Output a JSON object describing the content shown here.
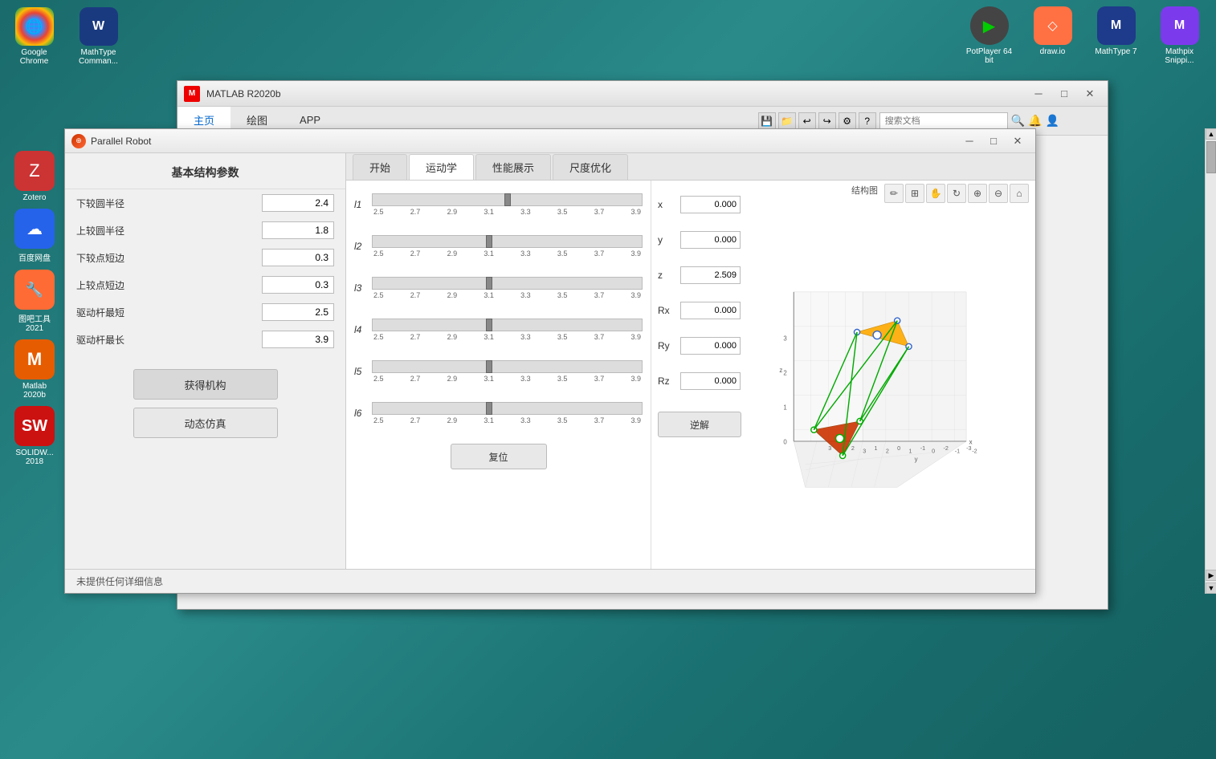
{
  "desktop": {
    "background_color": "#1a6b6b"
  },
  "top_icons": [
    {
      "id": "google-chrome",
      "label": "Google Chrome",
      "color": "#4285F4",
      "icon": "🌐"
    },
    {
      "id": "mathtype",
      "label": "MathType\nComman...",
      "color": "#1E3A8A",
      "icon": "M"
    },
    {
      "id": "zotero",
      "label": "Zotero",
      "color": "#CC3333",
      "icon": "Z"
    },
    {
      "id": "baidu",
      "label": "百度网盘",
      "color": "#2563EB",
      "icon": "☁"
    },
    {
      "id": "tuwenbao",
      "label": "图吧工具\n2021",
      "color": "#FF6B35",
      "icon": "🔧"
    },
    {
      "id": "matlab",
      "label": "Matlab\n2020b",
      "color": "#E65C00",
      "icon": "M"
    },
    {
      "id": "solidworks",
      "label": "SOLIDW...\n2018",
      "color": "#CC3333",
      "icon": "S"
    }
  ],
  "right_icons": [
    {
      "id": "potplayer",
      "label": "PotPlayer 64\nbit",
      "color": "#666",
      "icon": "▶"
    },
    {
      "id": "drawio",
      "label": "draw.io",
      "color": "#FF7043",
      "icon": "◇"
    },
    {
      "id": "mathtype7",
      "label": "MathType 7",
      "color": "#1E3A8A",
      "icon": "M"
    },
    {
      "id": "mathpix",
      "label": "Mathpix\nSnippi...",
      "color": "#7C3AED",
      "icon": "M"
    }
  ],
  "matlab_window": {
    "title": "MATLAB R2020b",
    "tabs": [
      "主页",
      "绘图",
      "APP"
    ],
    "active_tab": "主页",
    "search_placeholder": "搜索文档"
  },
  "robot_window": {
    "title": "Parallel Robot",
    "panel_title": "基本结构参数",
    "params": [
      {
        "id": "lower-circle-radius",
        "label": "下较圆半径",
        "value": "2.4"
      },
      {
        "id": "upper-circle-radius",
        "label": "上较圆半径",
        "value": "1.8"
      },
      {
        "id": "lower-point-short",
        "label": "下较点短边",
        "value": "0.3"
      },
      {
        "id": "upper-point-short",
        "label": "上较点短边",
        "value": "0.3"
      },
      {
        "id": "drive-rod-min",
        "label": "驱动杆最短",
        "value": "2.5"
      },
      {
        "id": "drive-rod-max",
        "label": "驱动杆最长",
        "value": "3.9"
      }
    ],
    "btn_get_mechanism": "获得机构",
    "btn_dynamic_sim": "动态仿真",
    "tabs": [
      "开始",
      "运动学",
      "性能展示",
      "尺度优化"
    ],
    "active_tab": "运动学",
    "sliders": [
      {
        "id": "l1",
        "label": "l1",
        "value": 0.5
      },
      {
        "id": "l2",
        "label": "l2",
        "value": 0.4
      },
      {
        "id": "l3",
        "label": "l3",
        "value": 0.4
      },
      {
        "id": "l4",
        "label": "l4",
        "value": 0.4
      },
      {
        "id": "l5",
        "label": "l5",
        "value": 0.4
      },
      {
        "id": "l6",
        "label": "l6",
        "value": 0.4
      }
    ],
    "slider_min": 2.5,
    "slider_max": 3.9,
    "slider_ticks": [
      "2.5",
      "2.7",
      "2.9",
      "3.1",
      "3.3",
      "3.5",
      "3.7",
      "3.9"
    ],
    "pose_values": [
      {
        "id": "x",
        "label": "x",
        "value": "0.000"
      },
      {
        "id": "y",
        "label": "y",
        "value": "0.000"
      },
      {
        "id": "z",
        "label": "z",
        "value": "2.509"
      },
      {
        "id": "rx",
        "label": "Rx",
        "value": "0.000"
      },
      {
        "id": "ry",
        "label": "Ry",
        "value": "0.000"
      },
      {
        "id": "rz",
        "label": "Rz",
        "value": "0.000"
      }
    ],
    "btn_reset": "复位",
    "btn_inverse": "逆解",
    "chart_label": "结构图",
    "status_text": "未提供任何详细信息"
  }
}
